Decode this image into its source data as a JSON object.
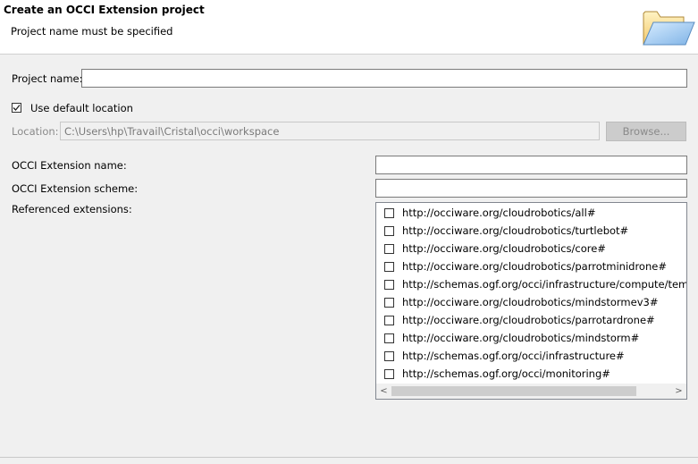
{
  "header": {
    "title": "Create an OCCI Extension project",
    "subtitle": "Project name must be specified",
    "icon": "folder-icon"
  },
  "form": {
    "project_name_label": "Project name:",
    "project_name_value": "",
    "use_default_location_label": "Use default location",
    "use_default_location_checked": true,
    "location_label": "Location:",
    "location_value": "C:\\Users\\hp\\Travail\\Cristal\\occi\\workspace",
    "browse_label": "Browse...",
    "extension_name_label": "OCCI Extension name:",
    "extension_name_value": "",
    "extension_scheme_label": "OCCI Extension scheme:",
    "extension_scheme_value": "",
    "referenced_extensions_label": "Referenced extensions:"
  },
  "referenced_extensions": [
    {
      "label": "http://occiware.org/cloudrobotics/all#",
      "checked": false
    },
    {
      "label": "http://occiware.org/cloudrobotics/turtlebot#",
      "checked": false
    },
    {
      "label": "http://occiware.org/cloudrobotics/core#",
      "checked": false
    },
    {
      "label": "http://occiware.org/cloudrobotics/parrotminidrone#",
      "checked": false
    },
    {
      "label": "http://schemas.ogf.org/occi/infrastructure/compute/templa",
      "checked": false
    },
    {
      "label": "http://occiware.org/cloudrobotics/mindstormev3#",
      "checked": false
    },
    {
      "label": "http://occiware.org/cloudrobotics/parrotardrone#",
      "checked": false
    },
    {
      "label": "http://occiware.org/cloudrobotics/mindstorm#",
      "checked": false
    },
    {
      "label": "http://schemas.ogf.org/occi/infrastructure#",
      "checked": false
    },
    {
      "label": "http://schemas.ogf.org/occi/monitoring#",
      "checked": false
    }
  ],
  "scrollbar": {
    "left_arrow": "<",
    "right_arrow": ">"
  }
}
